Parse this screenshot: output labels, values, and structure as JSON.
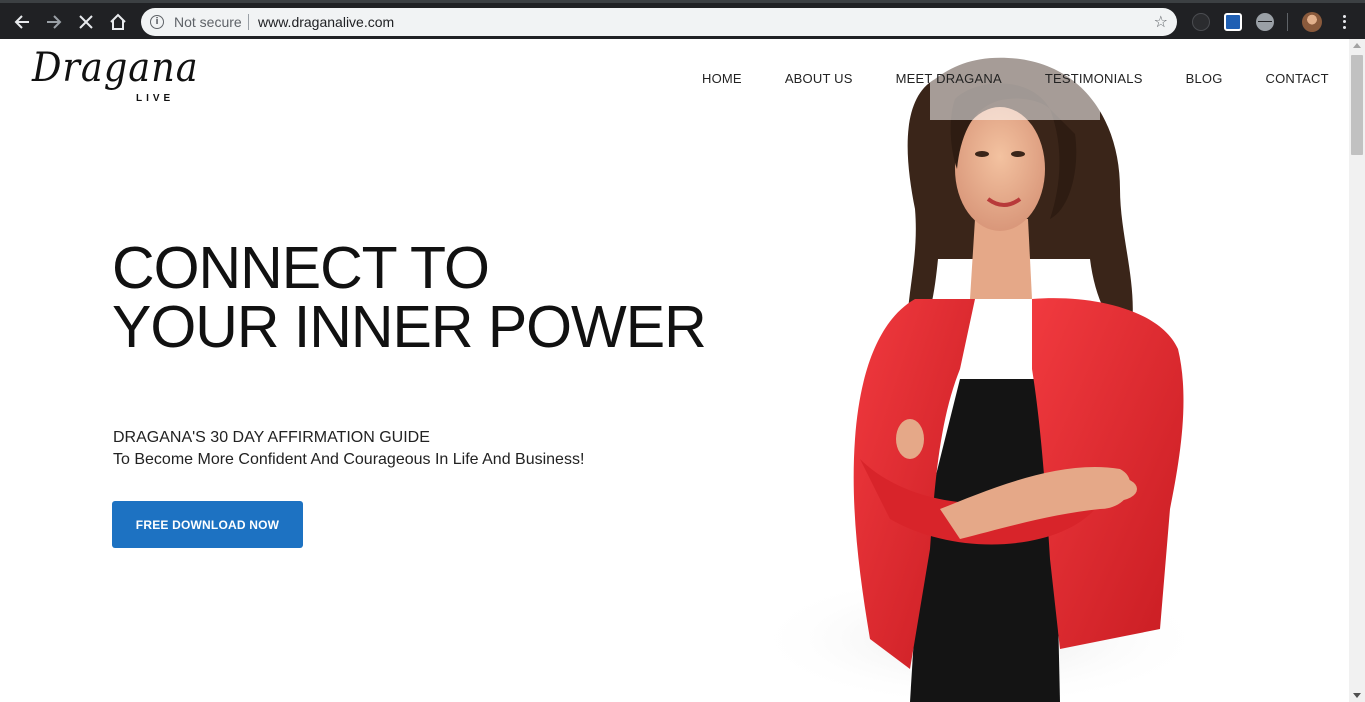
{
  "browser": {
    "security_label": "Not secure",
    "url": "www.draganalive.com",
    "back_icon": "arrow-left-icon",
    "forward_icon": "arrow-right-icon",
    "stop_icon": "close-icon",
    "home_icon": "home-icon",
    "info_icon": "info-icon",
    "info_glyph": "i",
    "star_icon": "star-icon",
    "star_glyph": "☆"
  },
  "site": {
    "logo": {
      "script": "Dragana",
      "sub": "LIVE"
    },
    "nav": [
      {
        "label": "HOME"
      },
      {
        "label": "ABOUT US"
      },
      {
        "label": "MEET DRAGANA"
      },
      {
        "label": "TESTIMONIALS"
      },
      {
        "label": "BLOG"
      },
      {
        "label": "CONTACT"
      }
    ],
    "hero": {
      "title_line1": "CONNECT TO",
      "title_line2": "YOUR INNER POWER",
      "subtitle_line1": "DRAGANA'S 30 DAY AFFIRMATION GUIDE",
      "subtitle_line2": "To Become More Confident And Courageous In Life And Business!",
      "cta_label": "FREE DOWNLOAD NOW"
    }
  },
  "colors": {
    "chrome_bg": "#202124",
    "omnibox_bg": "#f1f3f4",
    "cta_blue": "#1d72c2",
    "jacket_red": "#e8282d"
  }
}
